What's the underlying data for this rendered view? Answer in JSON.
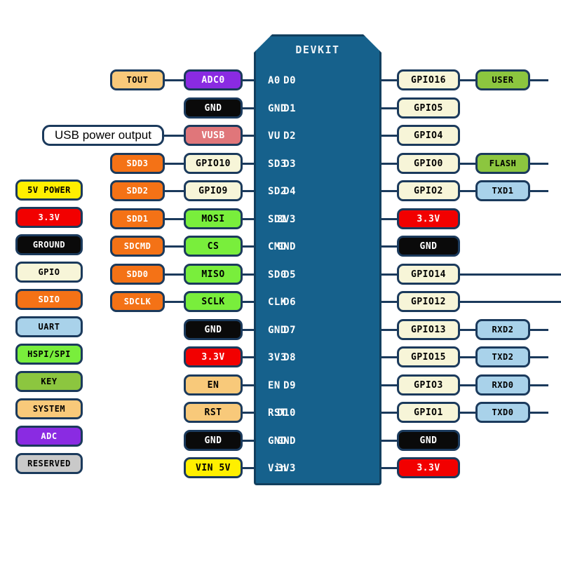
{
  "board": {
    "title": "DEVKIT",
    "color": "#16618c",
    "left_pins": [
      "A0",
      "GND",
      "VU",
      "SD3",
      "SD2",
      "SD1",
      "CMD",
      "SD0",
      "CLK",
      "GND",
      "3V3",
      "EN",
      "RST",
      "GND",
      "Vin"
    ],
    "right_pins": [
      "D0",
      "D1",
      "D2",
      "D3",
      "D4",
      "3V3",
      "GND",
      "D5",
      "D6",
      "D7",
      "D8",
      "D9",
      "D10",
      "GND",
      "3V3"
    ]
  },
  "legend": {
    "items": [
      {
        "label": "5V POWER",
        "bg": "#ffef00",
        "fg": "#000000"
      },
      {
        "label": "3.3V",
        "bg": "#f20000",
        "fg": "#ffffff"
      },
      {
        "label": "GROUND",
        "bg": "#0a0a0a",
        "fg": "#ffffff"
      },
      {
        "label": "GPIO",
        "bg": "#f7f5d8",
        "fg": "#000000"
      },
      {
        "label": "SDIO",
        "bg": "#f47216",
        "fg": "#ffffff"
      },
      {
        "label": "UART",
        "bg": "#a9d2ea",
        "fg": "#000000"
      },
      {
        "label": "HSPI/SPI",
        "bg": "#79ee3c",
        "fg": "#000000"
      },
      {
        "label": "KEY",
        "bg": "#8cc63f",
        "fg": "#000000"
      },
      {
        "label": "SYSTEM",
        "bg": "#f8c97a",
        "fg": "#000000"
      },
      {
        "label": "ADC",
        "bg": "#8a2be2",
        "fg": "#ffffff"
      },
      {
        "label": "RESERVED",
        "bg": "#c9c9c9",
        "fg": "#000000"
      }
    ]
  },
  "left_inner": [
    {
      "label": "ADC0",
      "bg": "#8a2be2",
      "fg": "#ffffff"
    },
    {
      "label": "GND",
      "bg": "#0a0a0a",
      "fg": "#ffffff"
    },
    {
      "label": "VUSB",
      "bg": "#e0767a",
      "fg": "#ffffff"
    },
    {
      "label": "GPIO10",
      "bg": "#f7f5d8",
      "fg": "#000000"
    },
    {
      "label": "GPIO9",
      "bg": "#f7f5d8",
      "fg": "#000000"
    },
    {
      "label": "MOSI",
      "bg": "#79ee3c",
      "fg": "#000000"
    },
    {
      "label": "CS",
      "bg": "#79ee3c",
      "fg": "#000000"
    },
    {
      "label": "MISO",
      "bg": "#79ee3c",
      "fg": "#000000"
    },
    {
      "label": "SCLK",
      "bg": "#79ee3c",
      "fg": "#000000"
    },
    {
      "label": "GND",
      "bg": "#0a0a0a",
      "fg": "#ffffff"
    },
    {
      "label": "3.3V",
      "bg": "#f20000",
      "fg": "#ffffff"
    },
    {
      "label": "EN",
      "bg": "#f8c97a",
      "fg": "#000000"
    },
    {
      "label": "RST",
      "bg": "#f8c97a",
      "fg": "#000000"
    },
    {
      "label": "GND",
      "bg": "#0a0a0a",
      "fg": "#ffffff"
    },
    {
      "label": "VIN 5V",
      "bg": "#ffef00",
      "fg": "#000000"
    }
  ],
  "left_outer": [
    {
      "label": "TOUT",
      "bg": "#f8c97a",
      "fg": "#000000",
      "row": 0
    },
    {
      "label": "SDD3",
      "bg": "#f47216",
      "fg": "#ffffff",
      "row": 3
    },
    {
      "label": "SDD2",
      "bg": "#f47216",
      "fg": "#ffffff",
      "row": 4
    },
    {
      "label": "SDD1",
      "bg": "#f47216",
      "fg": "#ffffff",
      "row": 5
    },
    {
      "label": "SDCMD",
      "bg": "#f47216",
      "fg": "#ffffff",
      "row": 6
    },
    {
      "label": "SDD0",
      "bg": "#f47216",
      "fg": "#ffffff",
      "row": 7
    },
    {
      "label": "SDCLK",
      "bg": "#f47216",
      "fg": "#ffffff",
      "row": 8
    }
  ],
  "left_note": {
    "label": "USB power output",
    "row": 2
  },
  "right_inner": [
    {
      "label": "GPIO16",
      "bg": "#f7f5d8",
      "fg": "#000000",
      "row": 0
    },
    {
      "label": "GPIO5",
      "bg": "#f7f5d8",
      "fg": "#000000",
      "row": 1
    },
    {
      "label": "GPIO4",
      "bg": "#f7f5d8",
      "fg": "#000000",
      "row": 2
    },
    {
      "label": "GPIO0",
      "bg": "#f7f5d8",
      "fg": "#000000",
      "row": 3
    },
    {
      "label": "GPIO2",
      "bg": "#f7f5d8",
      "fg": "#000000",
      "row": 4
    },
    {
      "label": "3.3V",
      "bg": "#f20000",
      "fg": "#ffffff",
      "row": 5
    },
    {
      "label": "GND",
      "bg": "#0a0a0a",
      "fg": "#ffffff",
      "row": 6
    },
    {
      "label": "GPIO14",
      "bg": "#f7f5d8",
      "fg": "#000000",
      "row": 7
    },
    {
      "label": "GPIO12",
      "bg": "#f7f5d8",
      "fg": "#000000",
      "row": 8
    },
    {
      "label": "GPIO13",
      "bg": "#f7f5d8",
      "fg": "#000000",
      "row": 9
    },
    {
      "label": "GPIO15",
      "bg": "#f7f5d8",
      "fg": "#000000",
      "row": 10
    },
    {
      "label": "GPIO3",
      "bg": "#f7f5d8",
      "fg": "#000000",
      "row": 11
    },
    {
      "label": "GPIO1",
      "bg": "#f7f5d8",
      "fg": "#000000",
      "row": 12
    },
    {
      "label": "GND",
      "bg": "#0a0a0a",
      "fg": "#ffffff",
      "row": 13
    },
    {
      "label": "3.3V",
      "bg": "#f20000",
      "fg": "#ffffff",
      "row": 14
    }
  ],
  "right_outer": [
    {
      "label": "USER",
      "bg": "#8cc63f",
      "fg": "#000000",
      "row": 0
    },
    {
      "label": "FLASH",
      "bg": "#8cc63f",
      "fg": "#000000",
      "row": 3
    },
    {
      "label": "TXD1",
      "bg": "#a9d2ea",
      "fg": "#000000",
      "row": 4
    },
    {
      "label": "RXD2",
      "bg": "#a9d2ea",
      "fg": "#000000",
      "row": 9
    },
    {
      "label": "TXD2",
      "bg": "#a9d2ea",
      "fg": "#000000",
      "row": 10
    },
    {
      "label": "RXD0",
      "bg": "#a9d2ea",
      "fg": "#000000",
      "row": 11
    },
    {
      "label": "TXD0",
      "bg": "#a9d2ea",
      "fg": "#000000",
      "row": 12
    }
  ],
  "edge_wire_rows": [
    7,
    8
  ]
}
